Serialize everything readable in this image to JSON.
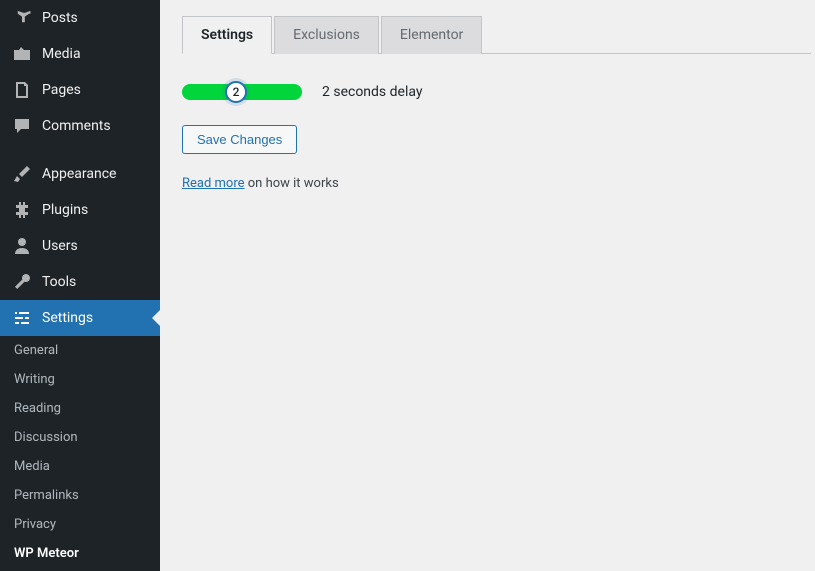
{
  "sidebar": {
    "items": [
      {
        "label": "Posts"
      },
      {
        "label": "Media"
      },
      {
        "label": "Pages"
      },
      {
        "label": "Comments"
      },
      {
        "label": "Appearance"
      },
      {
        "label": "Plugins"
      },
      {
        "label": "Users"
      },
      {
        "label": "Tools"
      },
      {
        "label": "Settings"
      }
    ],
    "submenu": [
      {
        "label": "General"
      },
      {
        "label": "Writing"
      },
      {
        "label": "Reading"
      },
      {
        "label": "Discussion"
      },
      {
        "label": "Media"
      },
      {
        "label": "Permalinks"
      },
      {
        "label": "Privacy"
      },
      {
        "label": "WP Meteor"
      }
    ]
  },
  "tabs": [
    {
      "label": "Settings"
    },
    {
      "label": "Exclusions"
    },
    {
      "label": "Elementor"
    }
  ],
  "slider": {
    "value": "2"
  },
  "delay_text": "2 seconds delay",
  "save_button": "Save Changes",
  "info": {
    "link": "Read more",
    "rest": " on how it works"
  }
}
